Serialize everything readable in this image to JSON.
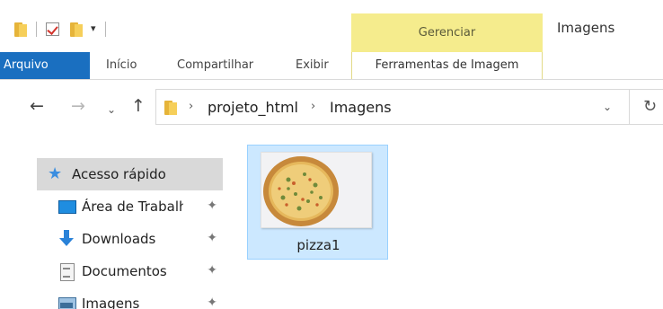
{
  "title_bar": {
    "window_title": "Imagens",
    "context_tab_group": "Gerenciar"
  },
  "quick_access_toolbar": {
    "icons": [
      "folder-icon",
      "properties-check-icon",
      "new-folder-icon",
      "customize-dropdown-icon"
    ]
  },
  "ribbon": {
    "tabs": [
      {
        "label": "Arquivo",
        "active": true
      },
      {
        "label": "Início"
      },
      {
        "label": "Compartilhar"
      },
      {
        "label": "Exibir"
      },
      {
        "label": "Ferramentas de Imagem",
        "context": true
      }
    ]
  },
  "navigation": {
    "back": "←",
    "forward": "→",
    "recent": "⌄",
    "up": "↑",
    "breadcrumb": [
      "projeto_html",
      "Imagens"
    ],
    "separator": "›",
    "dropdown": "⌄",
    "refresh": "↻"
  },
  "nav_pane": {
    "items": [
      {
        "label": "Acesso rápido",
        "icon": "star-icon",
        "selected": true
      },
      {
        "label": "Área de Trabalho",
        "icon": "desktop-icon",
        "pinned": true
      },
      {
        "label": "Downloads",
        "icon": "download-icon",
        "pinned": true
      },
      {
        "label": "Documentos",
        "icon": "documents-icon",
        "pinned": true
      },
      {
        "label": "Imagens",
        "icon": "pictures-icon",
        "pinned": true
      }
    ],
    "pin_glyph": "✦"
  },
  "content": {
    "files": [
      {
        "name": "pizza1",
        "type": "image",
        "selected": true
      }
    ]
  },
  "colors": {
    "file_tab": "#1a6fc0",
    "manage_highlight": "#f5ec8d",
    "selection": "#cce8ff",
    "selection_border": "#99d1ff",
    "nav_selected": "#d9d9d9"
  }
}
